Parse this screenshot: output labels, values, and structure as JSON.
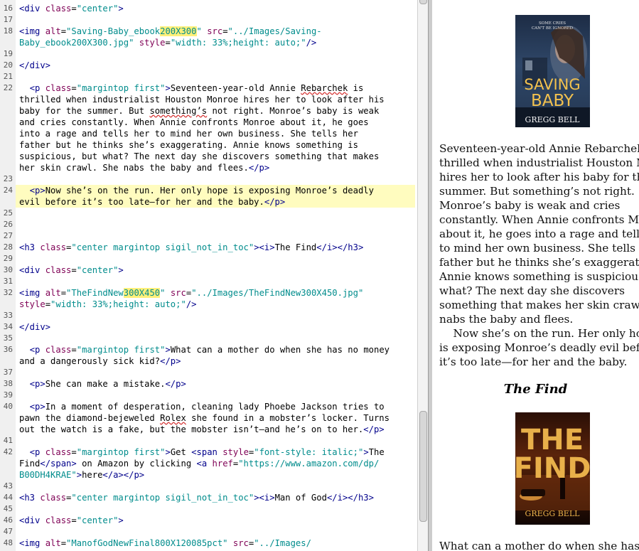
{
  "editor": {
    "line_numbers": [
      "16",
      "17",
      "18",
      "19",
      "20",
      "21",
      "22",
      "23",
      "24",
      "25",
      "26",
      "27",
      "28",
      "29",
      "30",
      "31",
      "32",
      "33",
      "34",
      "35",
      "36",
      "37",
      "38",
      "39",
      "40",
      "41",
      "42",
      "43",
      "44",
      "45",
      "46",
      "47",
      "48"
    ],
    "code": {
      "l16": {
        "t1": "<div ",
        "a1": "class",
        "eq1": "=",
        "v1": "\"center\"",
        "t2": ">"
      },
      "l18a": {
        "t1": "<img ",
        "a1": "alt",
        "eq1": "=",
        "v1a": "\"Saving-Baby_ebook",
        "v1h": "200X300",
        "v1b": "\"",
        "sp": " ",
        "a2": "src",
        "eq2": "=",
        "v2": "\"../Images/Saving-"
      },
      "l18b": {
        "v2": "Baby_ebook200X300.jpg\"",
        "sp": " ",
        "a3": "style",
        "eq3": "=",
        "v3": "\"width: 33%;height: auto;\"",
        "t": "/>"
      },
      "l20": {
        "t": "</div>"
      },
      "l22a": {
        "ind": "  ",
        "t1": "<p ",
        "a1": "class",
        "eq1": "=",
        "v1": "\"margintop first\"",
        "t2": ">",
        "txt1": "Seventeen-year-old Annie ",
        "sq": "Rebarchek",
        "txt2": " is"
      },
      "l22b": {
        "txt": "thrilled when industrialist Houston Monroe hires her to look after his"
      },
      "l22c": {
        "txt1": "baby for the summer. But ",
        "sq": "something’s",
        "txt2": " not right. Monroe’s baby is weak"
      },
      "l22d": {
        "txt": "and cries constantly. When Annie confronts Monroe about it, he goes"
      },
      "l22e": {
        "txt": "into a rage and tells her to mind her own business. She tells her"
      },
      "l22f": {
        "txt": "father but he thinks she’s exaggerating. Annie knows something is"
      },
      "l22g": {
        "txt": "suspicious, but what? The next day she discovers something that makes"
      },
      "l22h": {
        "txt": "her skin crawl. She nabs the baby and flees.",
        "t": "</p>"
      },
      "l24a": {
        "ind": "  ",
        "t1": "<p>",
        "txt": "Now she’s on the run. Her only hope is exposing Monroe’s deadly"
      },
      "l24b": {
        "txt": "evil before it’s too late—for her and the baby.",
        "t": "</p>"
      },
      "l28": {
        "t1": "<h3 ",
        "a1": "class",
        "eq1": "=",
        "v1": "\"center margintop sigil_not_in_toc\"",
        "t2": "><i>",
        "txt": "The Find",
        "t3": "</i></h3>"
      },
      "l30": {
        "t1": "<div ",
        "a1": "class",
        "eq1": "=",
        "v1": "\"center\"",
        "t2": ">"
      },
      "l32a": {
        "t1": "<img ",
        "a1": "alt",
        "eq1": "=",
        "v1a": "\"TheFindNew",
        "v1h": "300X450",
        "v1b": "\"",
        "sp": " ",
        "a2": "src",
        "eq2": "=",
        "v2": "\"../Images/TheFindNew300X450.jpg\""
      },
      "l32b": {
        "a3": "style",
        "eq3": "=",
        "v3": "\"width: 33%;height: auto;\"",
        "t": "/>"
      },
      "l34": {
        "t": "</div>"
      },
      "l36a": {
        "ind": "  ",
        "t1": "<p ",
        "a1": "class",
        "eq1": "=",
        "v1": "\"margintop first\"",
        "t2": ">",
        "txt": "What can a mother do when she has no money"
      },
      "l36b": {
        "txt": "and a dangerously sick kid?",
        "t": "</p>"
      },
      "l38": {
        "ind": "  ",
        "t1": "<p>",
        "txt": "She can make a mistake.",
        "t2": "</p>"
      },
      "l40a": {
        "ind": "  ",
        "t1": "<p>",
        "txt": "In a moment of desperation, cleaning lady Phoebe Jackson tries to"
      },
      "l40b": {
        "txt1": "pawn the diamond-bejeweled ",
        "sq": "Rolex",
        "txt2": " she found in a mobster’s locker. Turns"
      },
      "l40c": {
        "txt": "out the watch is a fake, but the mobster isn’t—and he’s on to her.",
        "t": "</p>"
      },
      "l42a": {
        "ind": "  ",
        "t1": "<p ",
        "a1": "class",
        "eq1": "=",
        "v1": "\"margintop first\"",
        "t2": ">",
        "txt1": "Get ",
        "t3": "<span ",
        "a2": "style",
        "eq2": "=",
        "v2": "\"font-style: italic;\"",
        "t4": ">",
        "txt2": "The"
      },
      "l42b": {
        "txt1": "Find",
        "t1": "</span>",
        "txt2": " on Amazon by clicking ",
        "t2": "<a ",
        "a1": "href",
        "eq1": "=",
        "v1": "\"https://www.amazon.com/dp/"
      },
      "l42c": {
        "v1": "B00DH4KRAE\"",
        "t1": ">",
        "txt": "here",
        "t2": "</a></p>"
      },
      "l44": {
        "t1": "<h3 ",
        "a1": "class",
        "eq1": "=",
        "v1": "\"center margintop sigil_not_in_toc\"",
        "t2": "><i>",
        "txt": "Man of God",
        "t3": "</i></h3>"
      },
      "l46": {
        "t1": "<div ",
        "a1": "class",
        "eq1": "=",
        "v1": "\"center\"",
        "t2": ">"
      },
      "l48": {
        "t1": "<img ",
        "a1": "alt",
        "eq1": "=",
        "v1": "\"ManofGodNewFinal800X120085pct\"",
        "sp": " ",
        "a2": "src",
        "eq2": "=",
        "v2": "\"../Images/"
      }
    }
  },
  "preview": {
    "cover1": {
      "tagline1": "SOME CRIES",
      "tagline2": "CAN'T BE IGNORED",
      "title1": "SAVING",
      "title2": "BABY",
      "author": "GREGG BELL"
    },
    "para1": [
      "Seventeen-year-old Annie Rebarchek is",
      "thrilled when industrialist Houston Mo",
      "hires her to look after his baby for th",
      "summer. But something’s not right.",
      "Monroe’s baby is weak and cries",
      "constantly. When Annie confronts Mor",
      "about it, he goes into a rage and tells",
      "to mind her own business. She tells h",
      "father but he thinks she’s exaggeratin",
      "Annie knows something is suspicious,",
      "what? The next day she discovers",
      "something that makes her skin crawl.",
      "nabs the baby and flees."
    ],
    "para2": [
      "    Now she’s on the run. Her only ho",
      "is exposing Monroe’s deadly evil befo",
      "it’s too late—for her and the baby."
    ],
    "heading": "The Find",
    "cover2": {
      "title1": "THE",
      "title2": "FIND",
      "author": "GREGG BELL"
    },
    "para3": [
      "What can a mother do when she has"
    ]
  },
  "colors": {
    "tag": "#00008b",
    "attribute": "#7f0055",
    "string": "#008c8c",
    "line_highlight": "#fffcbf",
    "search_highlight": "#fff07a"
  }
}
